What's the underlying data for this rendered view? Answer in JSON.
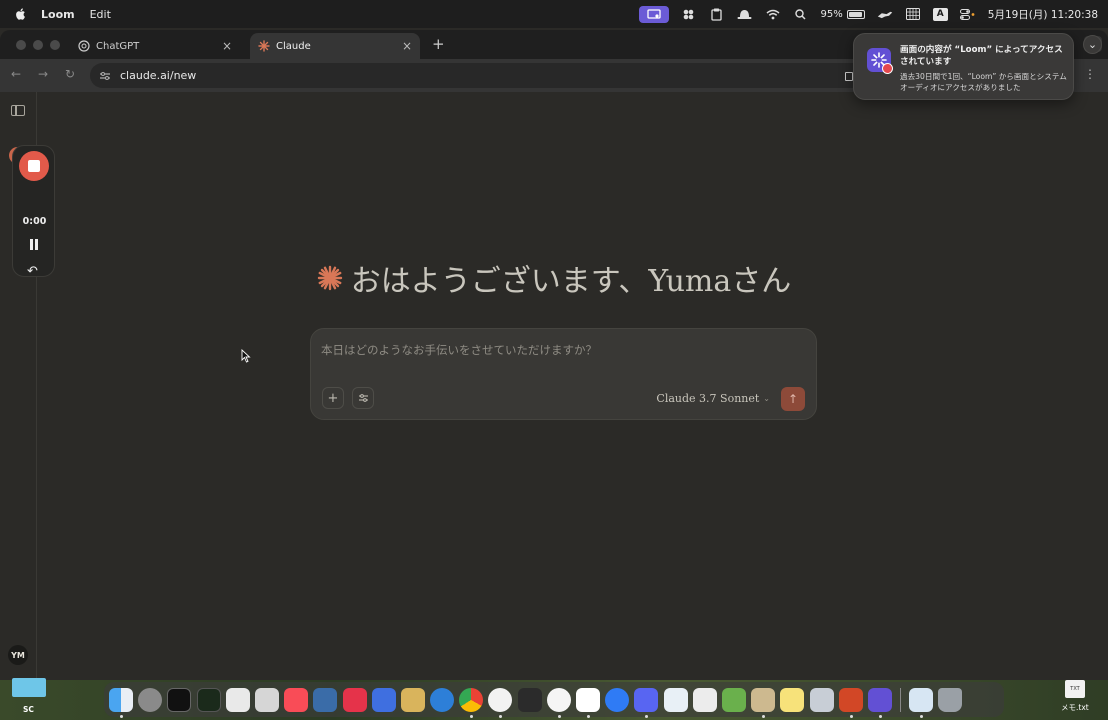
{
  "menubar": {
    "app_name": "Loom",
    "menu_edit": "Edit",
    "battery": "95%",
    "input_mode": "A",
    "datetime": "5月19日(月) 11:20:38"
  },
  "browser": {
    "tabs": [
      {
        "label": "ChatGPT",
        "icon": "chatgpt-icon"
      },
      {
        "label": "Claude",
        "icon": "claude-asterisk-icon"
      }
    ],
    "url": "claude.ai/new"
  },
  "loom_widget": {
    "timer": "0:00"
  },
  "sidebar": {
    "avatar_initials": "YM"
  },
  "main": {
    "greeting": "おはようございます、Yumaさん",
    "composer_placeholder": "本日はどのようなお手伝いをさせていただけますか？",
    "model_name": "Claude 3.7 Sonnet"
  },
  "notification": {
    "title": "画面の内容が “Loom” によってアクセスされています",
    "body": "過去30日間で1回、“Loom” から画面とシステムオーディオにアクセスがありました"
  },
  "desktop": {
    "folder_label": "SC",
    "file_icon_text": "TXT",
    "file_label": "メモ.txt"
  },
  "colors": {
    "accent": "#c9654a",
    "loom_purple": "#6250d4",
    "background": "#2b2a27"
  }
}
